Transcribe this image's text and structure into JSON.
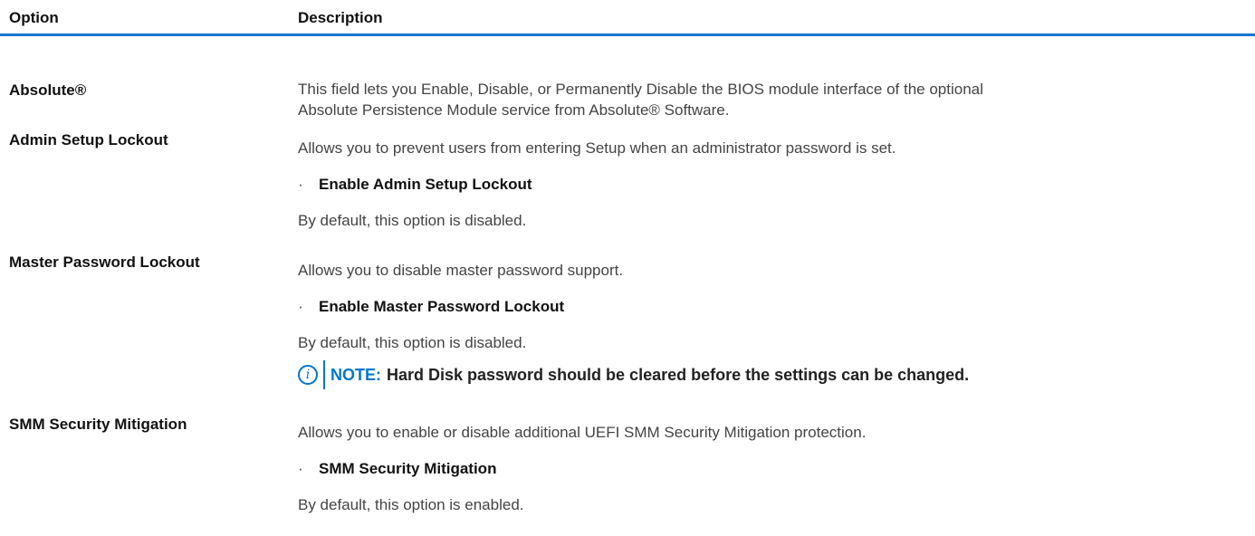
{
  "header": {
    "option": "Option",
    "description": "Description"
  },
  "rows": [
    {
      "option": "Absolute®",
      "lines": [
        "This field lets you Enable, Disable, or Permanently Disable the BIOS module interface of the optional",
        "Absolute Persistence Module service from Absolute® Software."
      ]
    },
    {
      "option": "Admin Setup Lockout",
      "lines": [
        "Allows you to prevent users from entering Setup when an administrator password is set."
      ],
      "bullet": "Enable Admin Setup Lockout",
      "default": "By default, this option is disabled."
    },
    {
      "option": "Master Password Lockout",
      "lines": [
        "Allows you to disable master password support."
      ],
      "bullet": "Enable Master Password Lockout",
      "default": "By default, this option is disabled.",
      "note": {
        "label": "NOTE:",
        "text": "Hard Disk password should be cleared before the settings can be changed.",
        "icon": "info-icon"
      }
    },
    {
      "option": "SMM Security Mitigation",
      "lines": [
        "Allows you to enable or disable additional UEFI SMM Security Mitigation protection."
      ],
      "bullet": "SMM Security Mitigation",
      "default": "By default, this option is enabled."
    }
  ],
  "colors": {
    "accent": "#0076ce",
    "text": "#444444",
    "heading": "#111111"
  },
  "bullet_glyph": "·",
  "note_icon_glyph": "i"
}
